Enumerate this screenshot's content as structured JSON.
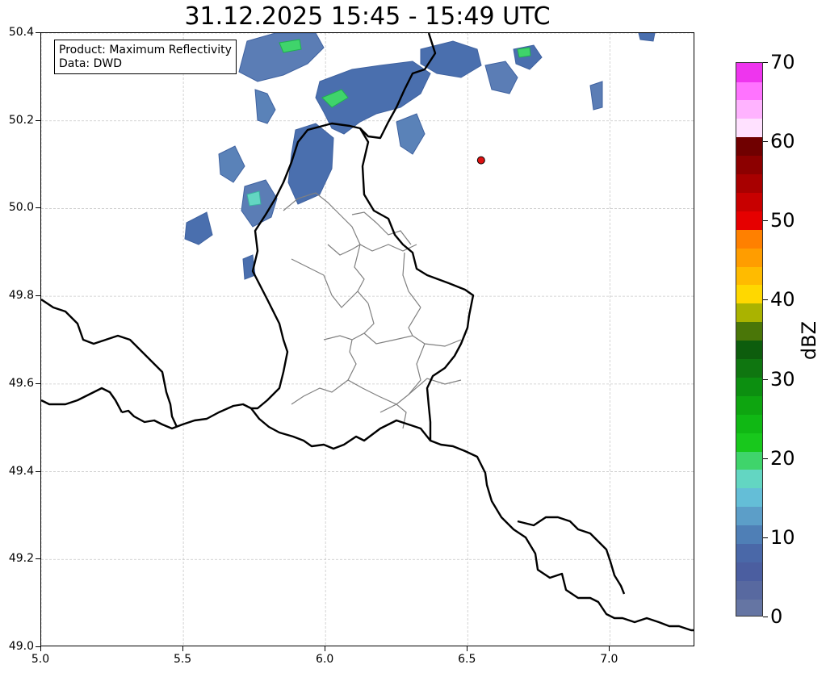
{
  "title": "31.12.2025 15:45 - 15:49 UTC",
  "info": {
    "product": "Product: Maximum Reflectivity",
    "data": "Data: DWD"
  },
  "map": {
    "lon_range": [
      5.0,
      7.3
    ],
    "lat_range": [
      49.0,
      50.4
    ],
    "x_ticks": [
      "5.0",
      "5.5",
      "6.0",
      "6.5",
      "7.0"
    ],
    "y_ticks": [
      "49.0",
      "49.2",
      "49.4",
      "49.6",
      "49.8",
      "50.0",
      "50.2",
      "50.4"
    ],
    "grid": "dashed light gray",
    "station_marker": {
      "lon": 6.547,
      "lat": 50.11,
      "color": "#dd1111"
    }
  },
  "colorbar": {
    "label": "dBZ",
    "ticks": [
      "0",
      "10",
      "20",
      "30",
      "40",
      "50",
      "60",
      "70"
    ],
    "levels": [
      0,
      70
    ],
    "colors": [
      "#6575a3",
      "#5869a0",
      "#4b5ea0",
      "#4a68a8",
      "#4f7fb6",
      "#5c9ec8",
      "#64bed7",
      "#63d6c2",
      "#3fd46b",
      "#18c81c",
      "#10b814",
      "#0ea510",
      "#0c8f10",
      "#0f7610",
      "#0d5d0d",
      "#4a7608",
      "#aab300",
      "#ffd800",
      "#ffbb00",
      "#ff9d00",
      "#ff8000",
      "#e60000",
      "#c80000",
      "#a80000",
      "#8c0000",
      "#700000",
      "#ffe1ff",
      "#ffb3ff",
      "#ff73ff",
      "#ee35ee"
    ]
  }
}
